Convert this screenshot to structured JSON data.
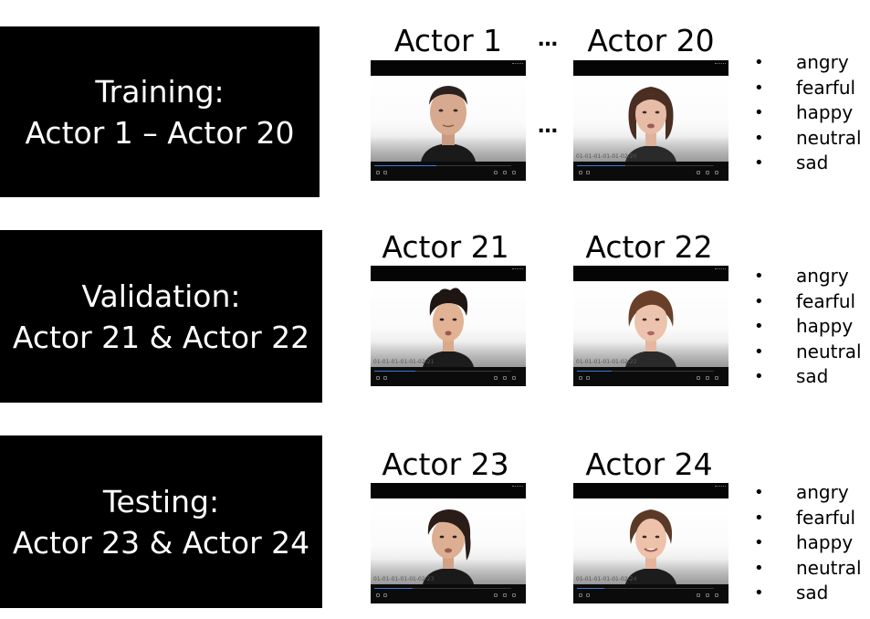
{
  "sections": [
    {
      "id": "training",
      "label_line1": "Training:",
      "label_line2": "Actor 1 – Actor 20",
      "actors": [
        {
          "title": "Actor 1",
          "filename": "",
          "progress": 0.45
        },
        {
          "title": "Actor 20",
          "filename": "01-01-01-01-01-02-20",
          "progress": 0.35
        }
      ],
      "has_ellipsis": true,
      "ellipsis": "…",
      "emotions": [
        "angry",
        "fearful",
        "happy",
        "neutral",
        "sad"
      ]
    },
    {
      "id": "validation",
      "label_line1": "Validation:",
      "label_line2": "Actor 21 & Actor 22",
      "actors": [
        {
          "title": "Actor 21",
          "filename": "01-01-01-01-01-02-21",
          "progress": 0.3
        },
        {
          "title": "Actor 22",
          "filename": "01-01-01-01-01-02-22",
          "progress": 0.25
        }
      ],
      "has_ellipsis": false,
      "ellipsis": "",
      "emotions": [
        "angry",
        "fearful",
        "happy",
        "neutral",
        "sad"
      ]
    },
    {
      "id": "testing",
      "label_line1": "Testing:",
      "label_line2": "Actor 23 & Actor 24",
      "actors": [
        {
          "title": "Actor 23",
          "filename": "01-01-01-01-01-02-23",
          "progress": 0.28
        },
        {
          "title": "Actor 24",
          "filename": "01-01-01-01-01-02-24",
          "progress": 0.2
        }
      ],
      "has_ellipsis": false,
      "ellipsis": "",
      "emotions": [
        "angry",
        "fearful",
        "happy",
        "neutral",
        "sad"
      ]
    }
  ],
  "bullet": "•",
  "colors": {
    "box_background": "#000000",
    "box_text": "#ffffff",
    "progress": "#3a7bd5"
  }
}
